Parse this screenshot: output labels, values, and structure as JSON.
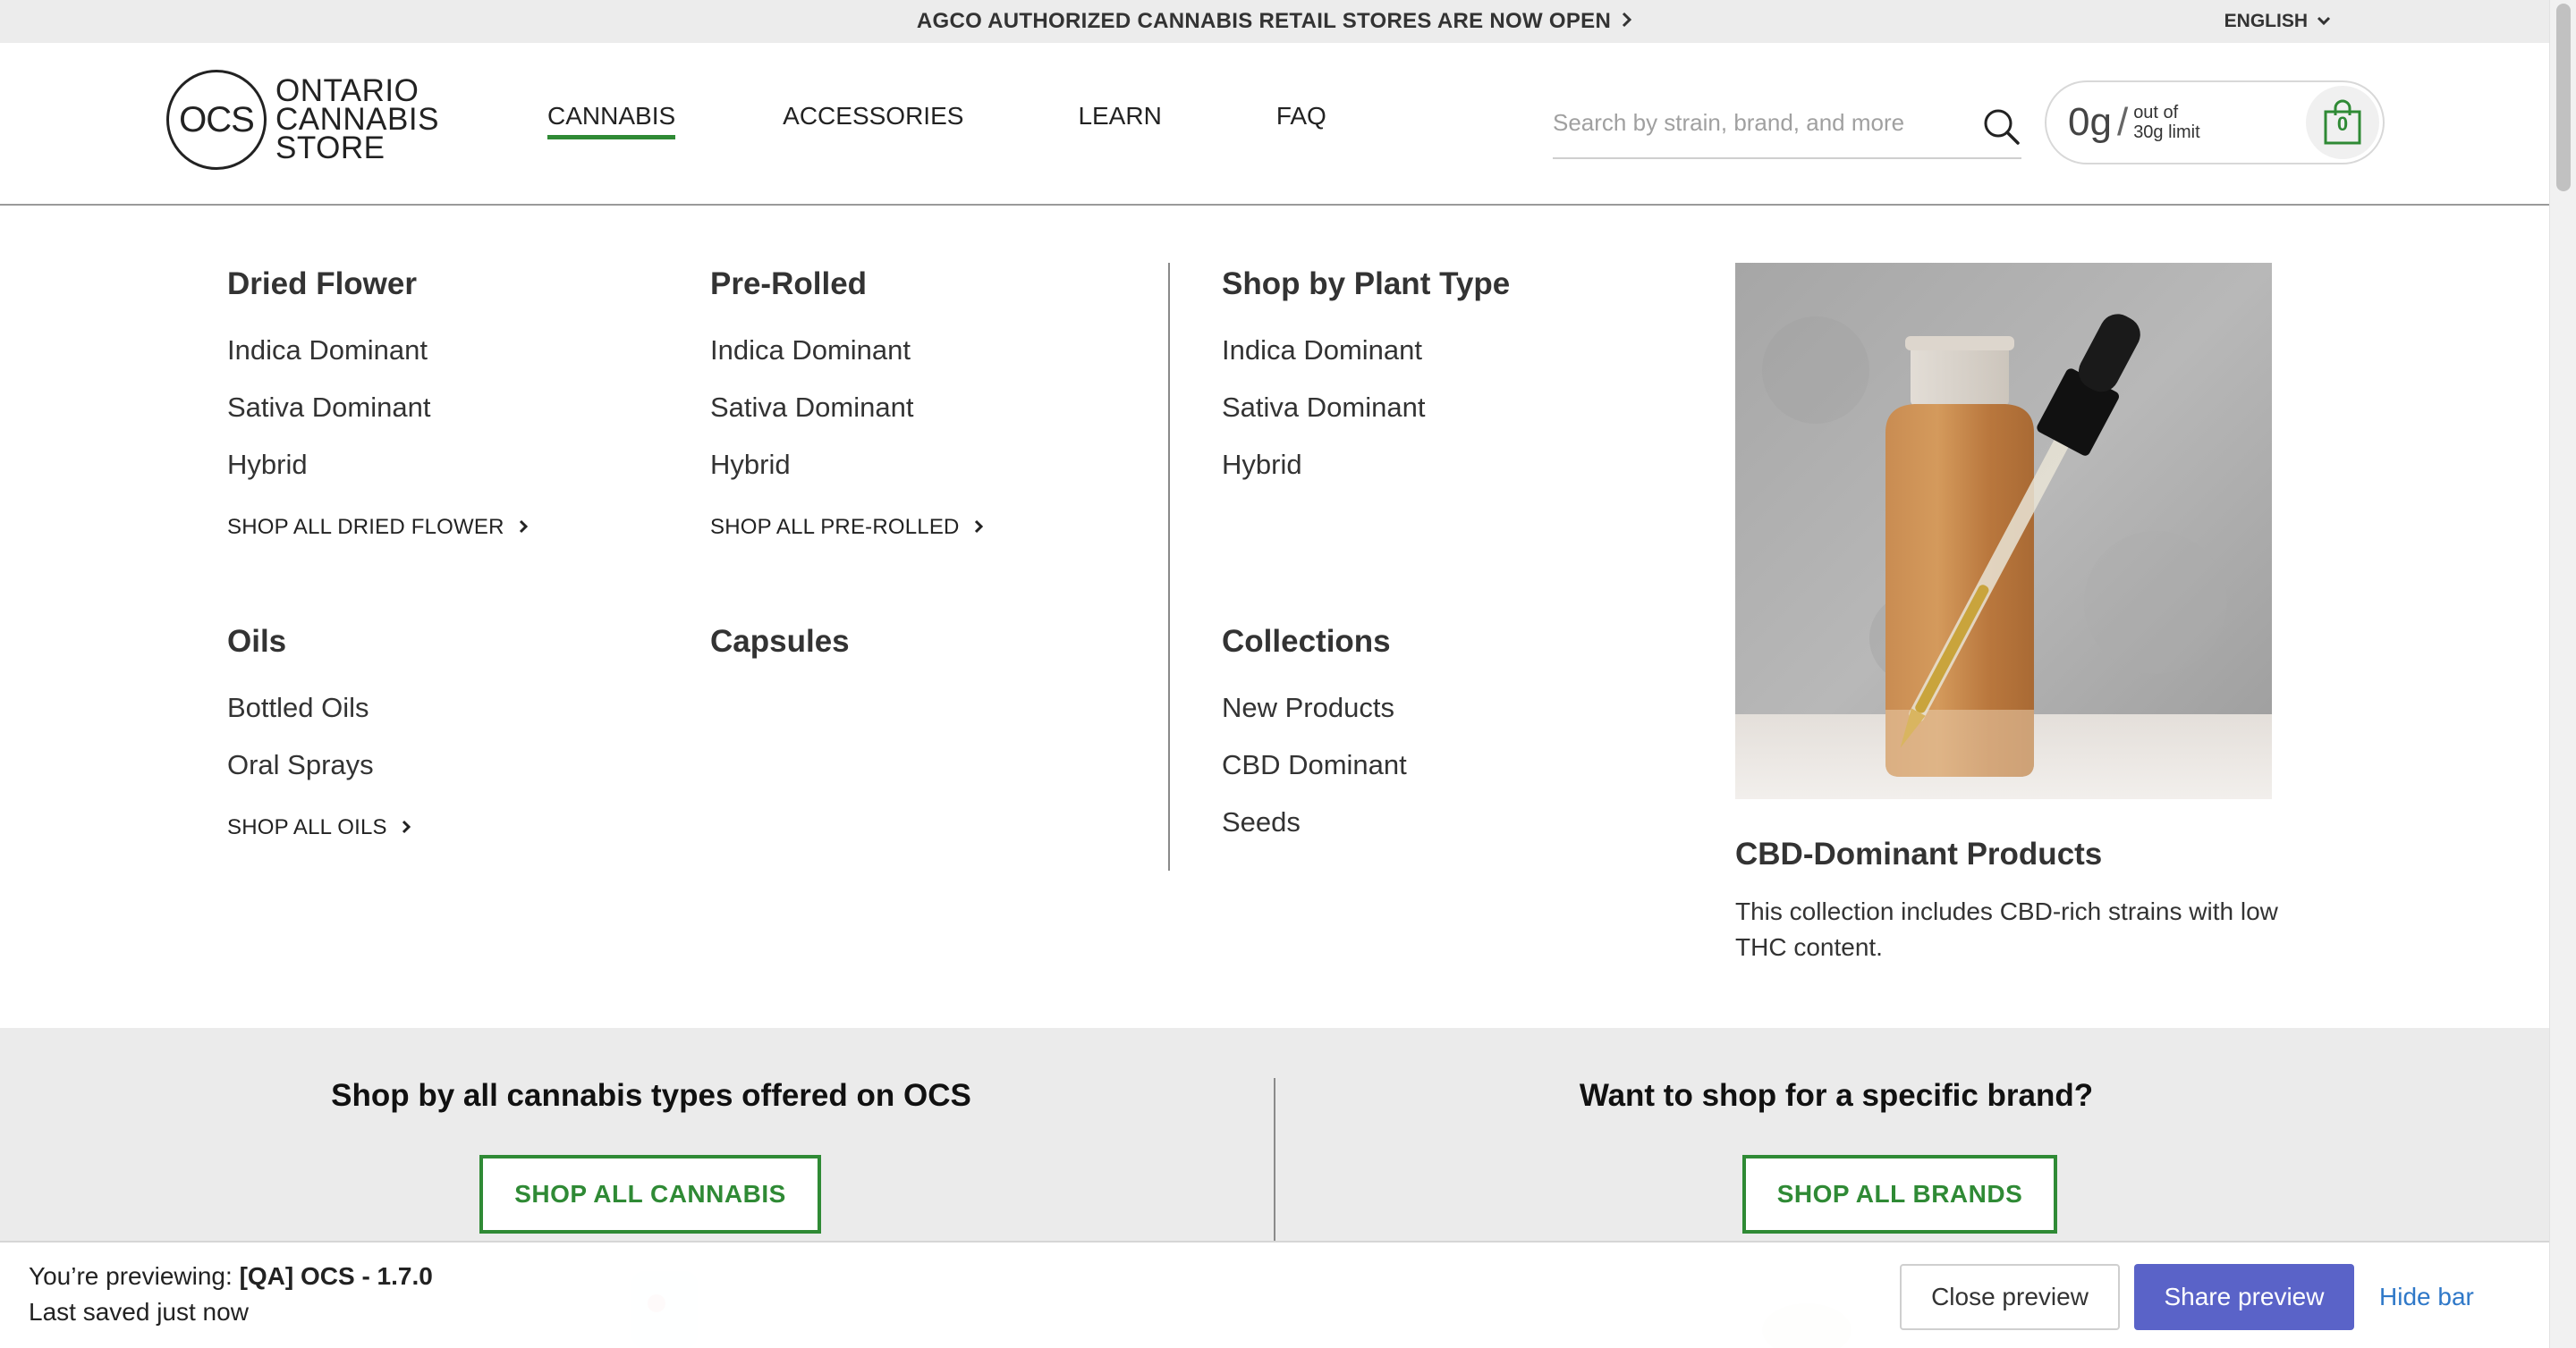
{
  "announcement": {
    "text": "AGCO AUTHORIZED CANNABIS RETAIL STORES ARE NOW OPEN",
    "icon": "chevron-right-icon"
  },
  "language": {
    "label": "ENGLISH",
    "icon": "chevron-down-icon"
  },
  "logo": {
    "mark": "OCS",
    "line1": "ONTARIO",
    "line2": "CANNABIS",
    "line3": "STORE"
  },
  "nav": {
    "items": [
      {
        "label": "CANNABIS",
        "active": true
      },
      {
        "label": "ACCESSORIES"
      },
      {
        "label": "LEARN"
      },
      {
        "label": "FAQ"
      }
    ]
  },
  "search": {
    "placeholder": "Search by strain, brand, and more",
    "value": "",
    "icon": "search-icon"
  },
  "cart": {
    "amount": "0g",
    "slash": "/",
    "limit_line1": "out of",
    "limit_line2": "30g limit",
    "count": "0",
    "icon": "shopping-bag-icon"
  },
  "menu": {
    "dried_flower": {
      "title": "Dried Flower",
      "links": [
        "Indica Dominant",
        "Sativa Dominant",
        "Hybrid"
      ],
      "shop_all": "SHOP ALL DRIED FLOWER"
    },
    "pre_rolled": {
      "title": "Pre-Rolled",
      "links": [
        "Indica Dominant",
        "Sativa Dominant",
        "Hybrid"
      ],
      "shop_all": "SHOP ALL PRE-ROLLED"
    },
    "oils": {
      "title": "Oils",
      "links": [
        "Bottled Oils",
        "Oral Sprays"
      ],
      "shop_all": "SHOP ALL OILS"
    },
    "capsules": {
      "title": "Capsules"
    },
    "plant_type": {
      "title": "Shop by Plant Type",
      "links": [
        "Indica Dominant",
        "Sativa Dominant",
        "Hybrid"
      ]
    },
    "collections": {
      "title": "Collections",
      "links": [
        "New Products",
        "CBD Dominant",
        "Seeds"
      ]
    },
    "promo": {
      "title": "CBD-Dominant Products",
      "text": "This collection includes CBD-rich strains with low THC content."
    }
  },
  "band": {
    "left": {
      "title": "Shop by all cannabis types offered on OCS",
      "button": "SHOP ALL CANNABIS"
    },
    "right": {
      "title": "Want to shop for a specific brand?",
      "button": "SHOP ALL BRANDS"
    }
  },
  "preview_bar": {
    "label": "You’re previewing:",
    "theme": "[QA] OCS - 1.7.0",
    "saved": "Last saved just now",
    "close": "Close preview",
    "share": "Share preview",
    "hide": "Hide bar"
  },
  "colors": {
    "accent_green": "#2f8a35",
    "share_button": "#5a63c8",
    "link_blue": "#2f78c8",
    "band_bg": "#ebebeb"
  }
}
